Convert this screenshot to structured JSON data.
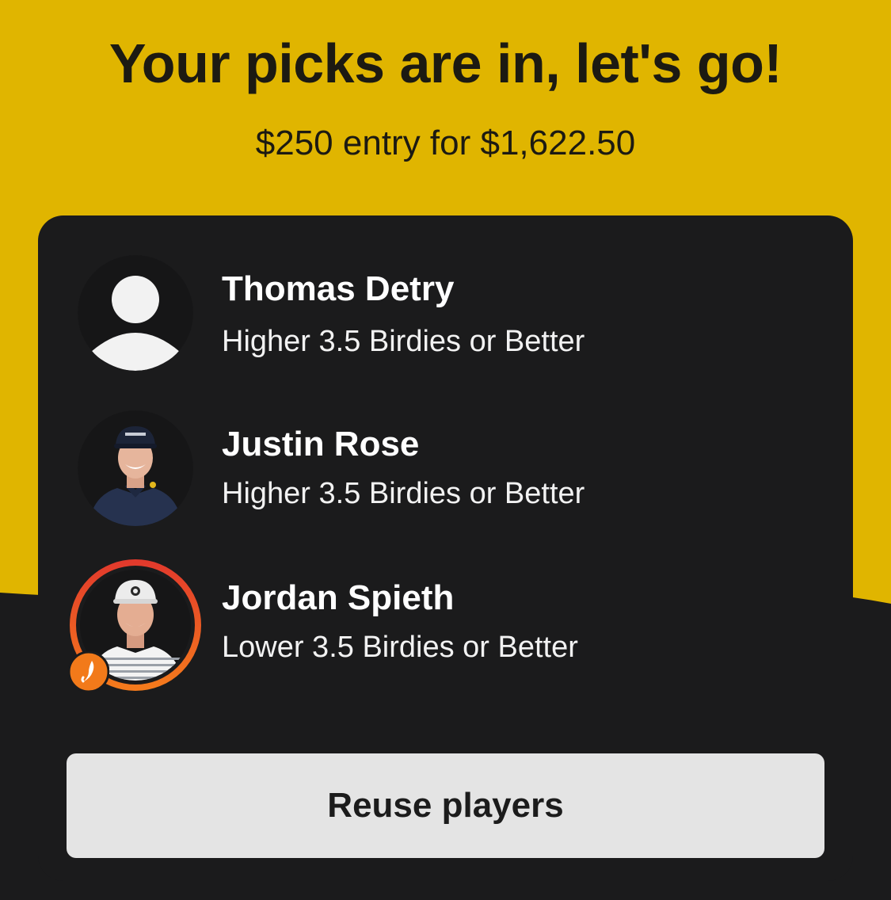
{
  "header": {
    "title": "Your picks are in, let's go!",
    "subtitle": "$250 entry for $1,622.50"
  },
  "picks": [
    {
      "name": "Thomas Detry",
      "detail": "Higher 3.5 Birdies or Better",
      "avatar": "default-person-icon"
    },
    {
      "name": "Justin Rose",
      "detail": "Higher 3.5 Birdies or Better",
      "avatar": "player-photo"
    },
    {
      "name": "Jordan Spieth",
      "detail": "Lower 3.5 Birdies or Better",
      "avatar": "player-photo",
      "badge": "flame-icon"
    }
  ],
  "actions": {
    "reuse_label": "Reuse players"
  },
  "colors": {
    "brand_yellow": "#e0b500",
    "background_dark": "#1b1b1c",
    "button_gray": "#e4e4e4",
    "ring_orange": "#f0562a",
    "badge_orange": "#f27a1a"
  }
}
